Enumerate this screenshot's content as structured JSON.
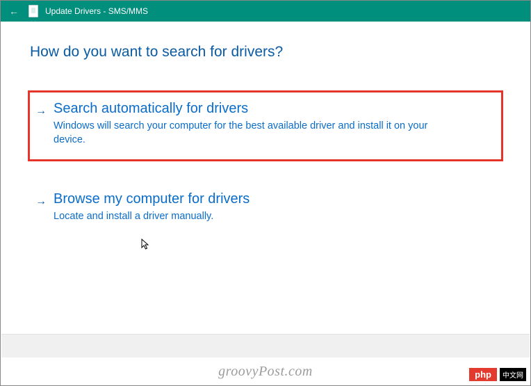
{
  "titlebar": {
    "title": "Update Drivers - SMS/MMS"
  },
  "heading": "How do you want to search for drivers?",
  "options": [
    {
      "arrow": "→",
      "title": "Search automatically for drivers",
      "desc": "Windows will search your computer for the best available driver and install it on your device.",
      "highlighted": true
    },
    {
      "arrow": "→",
      "title": "Browse my computer for drivers",
      "desc": "Locate and install a driver manually.",
      "highlighted": false
    }
  ],
  "watermark": "groovyPost.com",
  "badge": {
    "php": "php",
    "cn": "中文网"
  }
}
